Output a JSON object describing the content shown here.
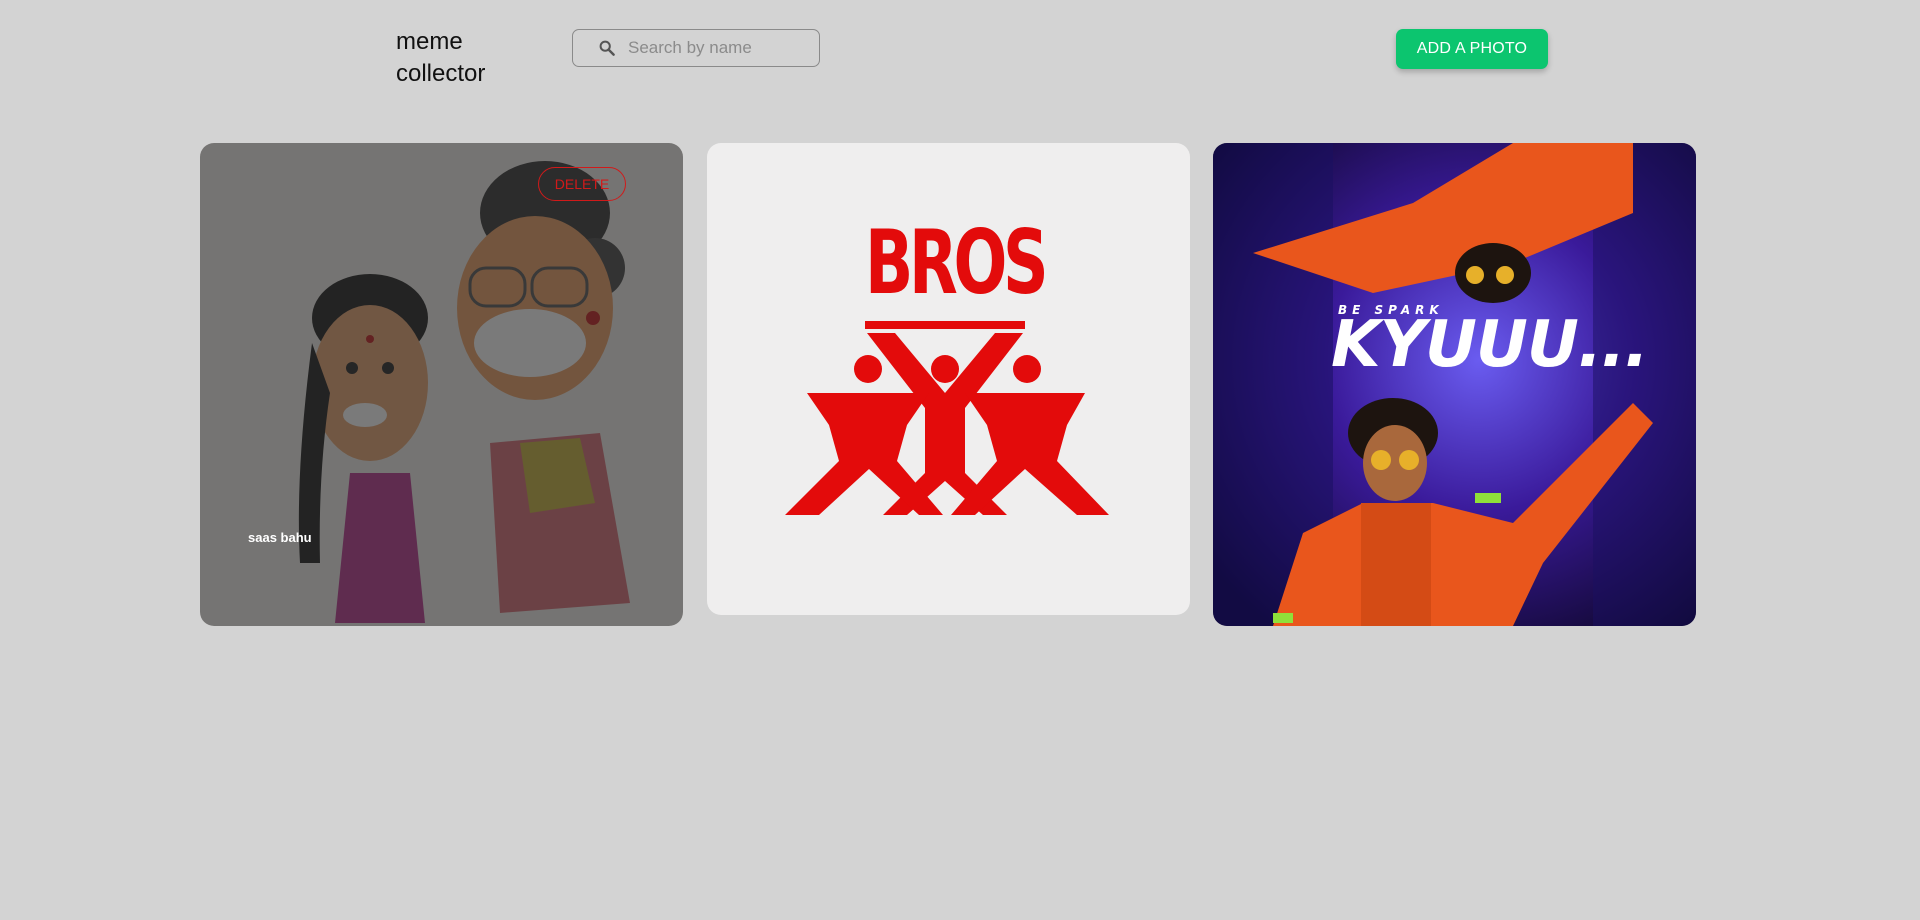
{
  "app": {
    "logo": "meme\ncollector"
  },
  "search": {
    "placeholder": "Search by name",
    "value": ""
  },
  "toolbar": {
    "add_label": "ADD A PHOTO"
  },
  "colors": {
    "background": "#d3d3d3",
    "accent": "#0cc56f",
    "danger": "#d11a1a"
  },
  "cards": [
    {
      "label": "saas bahu",
      "delete_label": "DELETE",
      "state": "hovered"
    },
    {
      "image_text": "BROS"
    },
    {
      "image_text": "KYUUU...",
      "image_subtext": "BE SPARK"
    }
  ]
}
